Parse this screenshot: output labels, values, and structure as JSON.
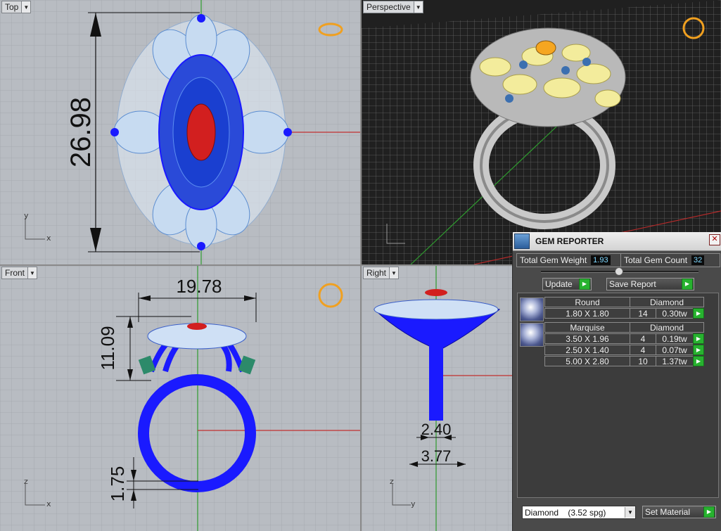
{
  "viewports": {
    "top": {
      "label": "Top",
      "axis_x": "x",
      "axis_y": "y",
      "dim": "26.98"
    },
    "perspective": {
      "label": "Perspective"
    },
    "front": {
      "label": "Front",
      "axis_x": "x",
      "axis_y": "z",
      "dim_width": "19.78",
      "dim_height": "11.09",
      "dim_band": "1.75"
    },
    "right": {
      "label": "Right",
      "axis_x": "y",
      "axis_y": "z",
      "dim_a": "2.40",
      "dim_b": "3.77"
    }
  },
  "gem_reporter": {
    "title": "GEM REPORTER",
    "close": "✕",
    "total_weight_label": "Total Gem Weight",
    "total_weight_value": "1.93",
    "total_count_label": "Total Gem Count",
    "total_count_value": "32",
    "update_label": "Update",
    "save_label": "Save Report",
    "groups": [
      {
        "cut": "Round",
        "material": "Diamond",
        "rows": [
          {
            "size": "1.80 X 1.80",
            "qty": "14",
            "weight": "0.30tw"
          }
        ]
      },
      {
        "cut": "Marquise",
        "material": "Diamond",
        "rows": [
          {
            "size": "3.50 X 1.96",
            "qty": "4",
            "weight": "0.19tw"
          },
          {
            "size": "2.50 X 1.40",
            "qty": "4",
            "weight": "0.07tw"
          },
          {
            "size": "5.00 X 2.80",
            "qty": "10",
            "weight": "1.37tw"
          }
        ]
      }
    ],
    "material_select": "Diamond    (3.52 spg)",
    "set_material_label": "Set Material"
  },
  "colors": {
    "viewport_bg": "#b8bcc2",
    "wire_blue": "#1a1aff",
    "gem_red": "#d21f1f",
    "grid_green": "#2e9a2e",
    "axis_red": "#c23030",
    "go_green": "#27b22f"
  }
}
